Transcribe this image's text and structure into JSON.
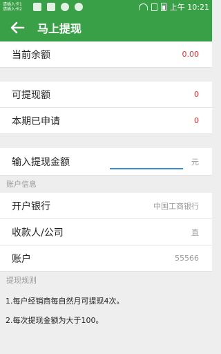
{
  "status_bar": {
    "carrier_lines": [
      "请插入卡1",
      "请插入卡2"
    ],
    "time": "上午 10:21"
  },
  "header": {
    "title": "马上提现"
  },
  "balance": {
    "label": "当前余额",
    "value": "0.00"
  },
  "withdrawable": {
    "label": "可提现额",
    "value": "0"
  },
  "applied": {
    "label": "本期已申请",
    "value": "0"
  },
  "amount_input": {
    "label": "输入提现金额",
    "value": "",
    "unit": "元"
  },
  "account_info": {
    "section_title": "账户信息",
    "bank_label": "开户银行",
    "bank_value": "中国工商银行",
    "payee_label": "收款人/公司",
    "payee_value": "直",
    "account_label": "账户",
    "account_value": "55566"
  },
  "rules": {
    "section_title": "提现规则",
    "items": [
      "1.每户经销商每自然月可提现4次。",
      "2.每次提现金额为大于100。"
    ]
  },
  "colors": {
    "accent": "#3aa048",
    "value_red": "#d03030",
    "input_underline": "#3a8ed0"
  }
}
